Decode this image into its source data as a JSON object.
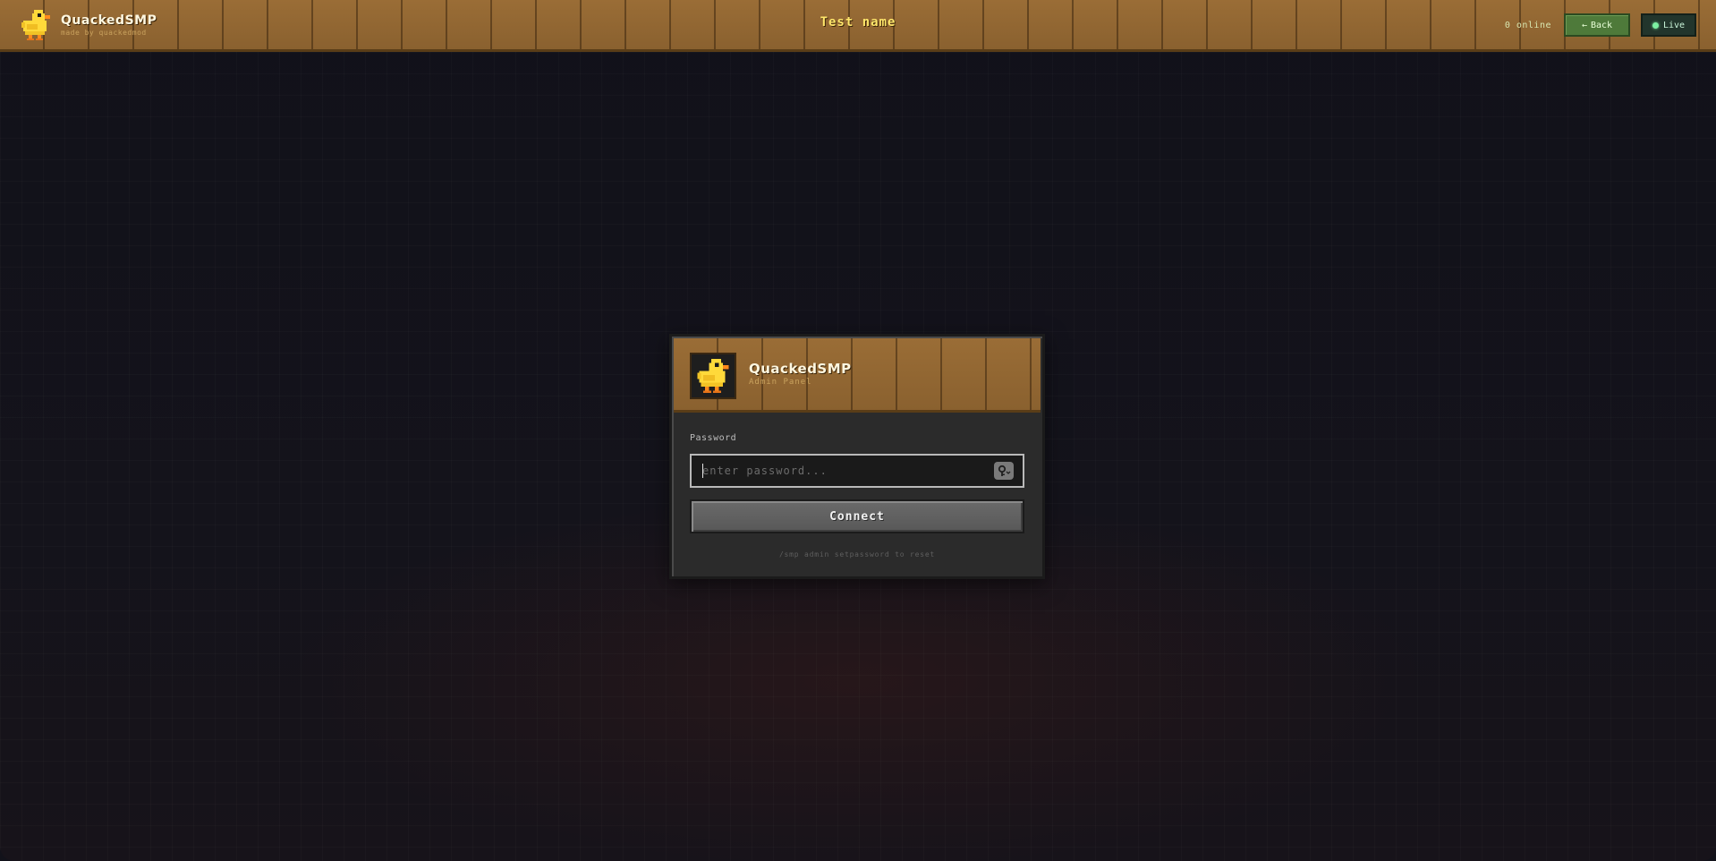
{
  "header": {
    "brand_name": "QuackedSMP",
    "brand_sub": "made by quackedmod",
    "page_title": "Test name",
    "online_count": "0 online",
    "back_label": "Back",
    "back_arrow": "←",
    "live_label": "Live"
  },
  "login": {
    "title": "QuackedSMP",
    "subtitle": "Admin Panel",
    "password_label": "Password",
    "password_value": "",
    "password_placeholder": "enter password...",
    "connect_label": "Connect",
    "hint": "/smp admin setpassword to reset"
  },
  "icons": {
    "logo": "duck-icon",
    "password_toggle": "key-icon",
    "status": "live-dot-icon"
  },
  "colors": {
    "plank": "#8d6330",
    "title_yellow": "#ffe66b",
    "back_green": "#4e7a3a",
    "live_bg": "#22352c",
    "live_dot": "#7cf0a2",
    "card_bg": "#2b2b2b",
    "page_bg": "#12121a"
  }
}
